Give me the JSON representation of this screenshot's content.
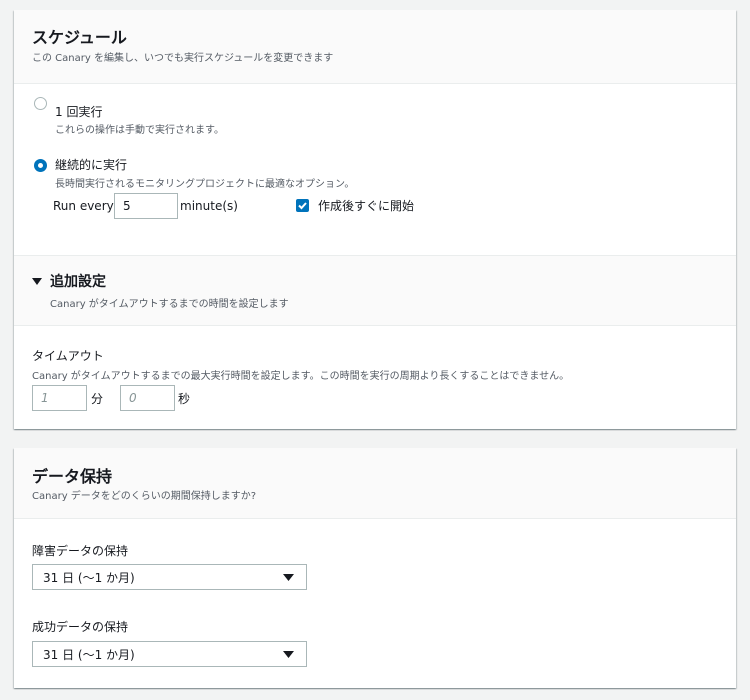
{
  "schedule": {
    "title": "スケジュール",
    "description": "この Canary を編集し、いつでも実行スケジュールを変更できます",
    "option_once": {
      "label": "1 回実行",
      "description": "これらの操作は手動で実行されます。",
      "selected": false
    },
    "option_continuous": {
      "label": "継続的に実行",
      "description": "長時間実行されるモニタリングプロジェクトに最適なオプション。",
      "selected": true
    },
    "run_every_label": "Run every",
    "run_every_value": "5",
    "run_every_unit": "minute(s)",
    "start_immediately": {
      "label": "作成後すぐに開始",
      "checked": true
    }
  },
  "additional_settings": {
    "title": "追加設定",
    "description": "Canary がタイムアウトするまでの時間を設定します",
    "expanded": true
  },
  "timeout": {
    "label": "タイムアウト",
    "description": "Canary がタイムアウトするまでの最大実行時間を設定します。この時間を実行の周期より長くすることはできません。",
    "minutes_placeholder": "1",
    "minutes_unit": "分",
    "seconds_placeholder": "0",
    "seconds_unit": "秒"
  },
  "retention": {
    "title": "データ保持",
    "description": "Canary データをどのくらいの期間保持しますか?",
    "failure_label": "障害データの保持",
    "failure_value": "31 日 (〜1 か月)",
    "success_label": "成功データの保持",
    "success_value": "31 日 (〜1 か月)"
  },
  "colors": {
    "accent": "#0073bb",
    "border": "#aab7b8",
    "muted_text": "#545b64",
    "background": "#f2f3f3"
  }
}
